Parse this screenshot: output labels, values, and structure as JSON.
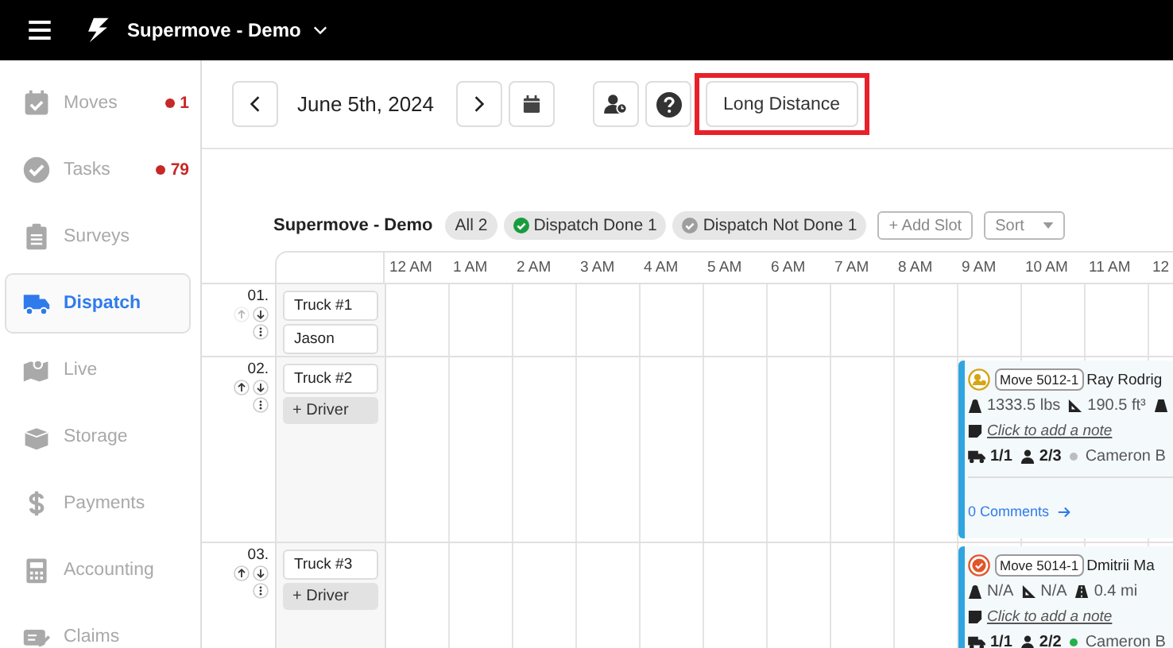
{
  "topbar": {
    "org": "Supermove - Demo"
  },
  "sidebar": {
    "items": [
      {
        "label": "Moves",
        "badge": "1",
        "selected": false
      },
      {
        "label": "Tasks",
        "badge": "79",
        "selected": false
      },
      {
        "label": "Surveys",
        "selected": false
      },
      {
        "label": "Dispatch",
        "selected": true
      },
      {
        "label": "Live",
        "selected": false
      },
      {
        "label": "Storage",
        "selected": false
      },
      {
        "label": "Payments",
        "selected": false
      },
      {
        "label": "Accounting",
        "selected": false
      },
      {
        "label": "Claims",
        "selected": false
      }
    ]
  },
  "toolbar": {
    "date": "June 5th, 2024",
    "mode_button": "Long Distance"
  },
  "filters": {
    "organization": "Supermove - Demo",
    "chips": [
      {
        "label": "All 2",
        "kind": "plain"
      },
      {
        "label": "Dispatch Done 1",
        "kind": "done"
      },
      {
        "label": "Dispatch Not Done 1",
        "kind": "not-done"
      }
    ],
    "add_slot": "+ Add Slot",
    "sort": "Sort"
  },
  "hours": [
    "12 AM",
    "1 AM",
    "2 AM",
    "3 AM",
    "4 AM",
    "5 AM",
    "6 AM",
    "7 AM",
    "8 AM",
    "9 AM",
    "10 AM",
    "11 AM",
    "12"
  ],
  "slots": [
    {
      "number": "01.",
      "can_move_up": false,
      "truck": "Truck #1",
      "driver": {
        "kind": "assigned",
        "label": "Jason"
      }
    },
    {
      "number": "02.",
      "can_move_up": true,
      "truck": "Truck #2",
      "driver": {
        "kind": "add",
        "label": "+ Driver"
      },
      "moves": [
        {
          "kind": "pending",
          "move_id": "Move 5012-1",
          "customer": "Ray Rodrig",
          "weight": "1333.5 lbs",
          "volume": "190.5 ft³",
          "note": "Click to add a note",
          "trucks": "1/1",
          "crew": {
            "count": "2/3",
            "color": "#bdbdbd"
          },
          "crew_lead": "Cameron B",
          "comments": "0 Comments"
        }
      ]
    },
    {
      "number": "03.",
      "can_move_up": true,
      "truck": "Truck #3",
      "driver": {
        "kind": "add",
        "label": "+ Driver"
      },
      "moves": [
        {
          "kind": "in-progress",
          "move_id": "Move 5014-1",
          "customer": "Dmitrii Ma",
          "weight": "N/A",
          "volume": "N/A",
          "distance": "0.4 mi",
          "note": "Click to add a note",
          "trucks": "1/1",
          "crew": {
            "count": "2/2",
            "color": "#22b14c"
          },
          "crew_lead": "Cameron B"
        }
      ]
    }
  ]
}
